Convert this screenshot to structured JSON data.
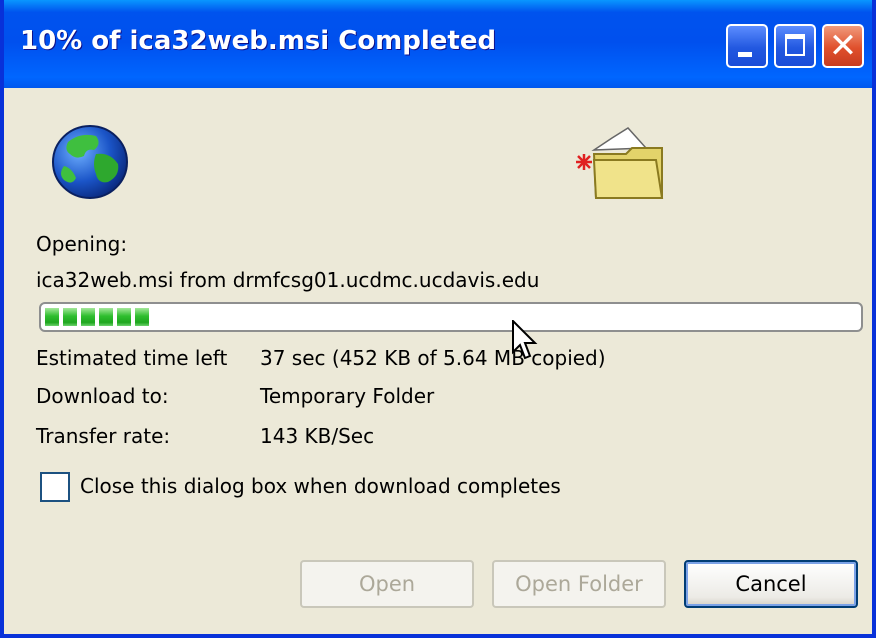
{
  "window": {
    "title": "10% of ica32web.msi Completed",
    "controls": {
      "minimize": "minimize",
      "maximize": "maximize",
      "close": "close"
    },
    "colors": {
      "titlebar": "#0053ee",
      "body": "#ece9d8",
      "progress": "#2ebe2e",
      "close_button": "#e0502c"
    }
  },
  "icons": {
    "source": "globe-icon",
    "destination": "folder-icon"
  },
  "opening_label": "Opening:",
  "source_text": "ica32web.msi from drmfcsg01.ucdmc.ucdavis.edu",
  "progress": {
    "percent": 10,
    "segments": 6
  },
  "details": [
    {
      "label": "Estimated time left",
      "value": "37 sec (452 KB of 5.64 MB copied)"
    },
    {
      "label": "Download to:",
      "value": "Temporary Folder"
    },
    {
      "label": "Transfer rate:",
      "value": "143 KB/Sec"
    }
  ],
  "close_checkbox": {
    "label": "Close this dialog box when download completes",
    "checked": false
  },
  "buttons": {
    "open": "Open",
    "open_folder": "Open Folder",
    "cancel": "Cancel"
  }
}
